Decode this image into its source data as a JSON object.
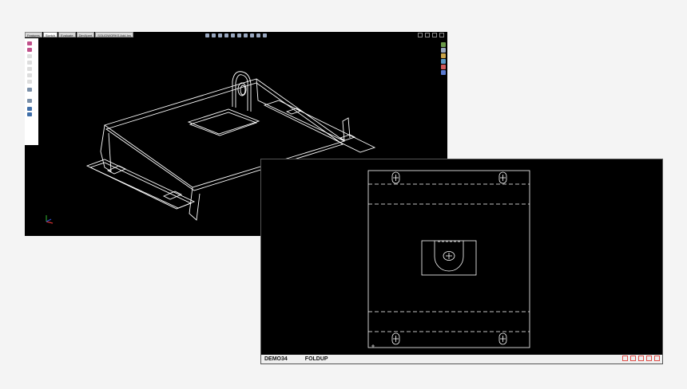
{
  "window_3d": {
    "tabs": [
      {
        "label": "Features"
      },
      {
        "label": "Sketch"
      },
      {
        "label": "Evaluate"
      },
      {
        "label": "DimXpert"
      },
      {
        "label": "SOLIDWORKS Add-Ins"
      }
    ],
    "active_tab": "Sketch",
    "heads_up_toolbar": [
      "zoom-to-fit-icon",
      "zoom-area-icon",
      "previous-view-icon",
      "section-view-icon",
      "view-orientation-icon",
      "display-style-icon",
      "hide-show-icon",
      "edit-appearance-icon",
      "scene-icon",
      "view-settings-icon"
    ],
    "task_pane_icons": [
      "resources-icon",
      "design-library-icon",
      "file-explorer-icon",
      "view-palette-icon",
      "appearances-icon",
      "custom-properties-icon"
    ]
  },
  "window_2d": {
    "status": {
      "part_name": "DEMO34",
      "mode": "FOLDUP"
    },
    "status_icons": [
      "layer-icon",
      "grid-icon",
      "snap-icon",
      "zoom-icon",
      "window-icon"
    ]
  },
  "colors": {
    "background": "#f4f4f4",
    "viewport": "#000000",
    "wireframe": "#ffffff",
    "status_icon_accent": "#e0504a"
  }
}
